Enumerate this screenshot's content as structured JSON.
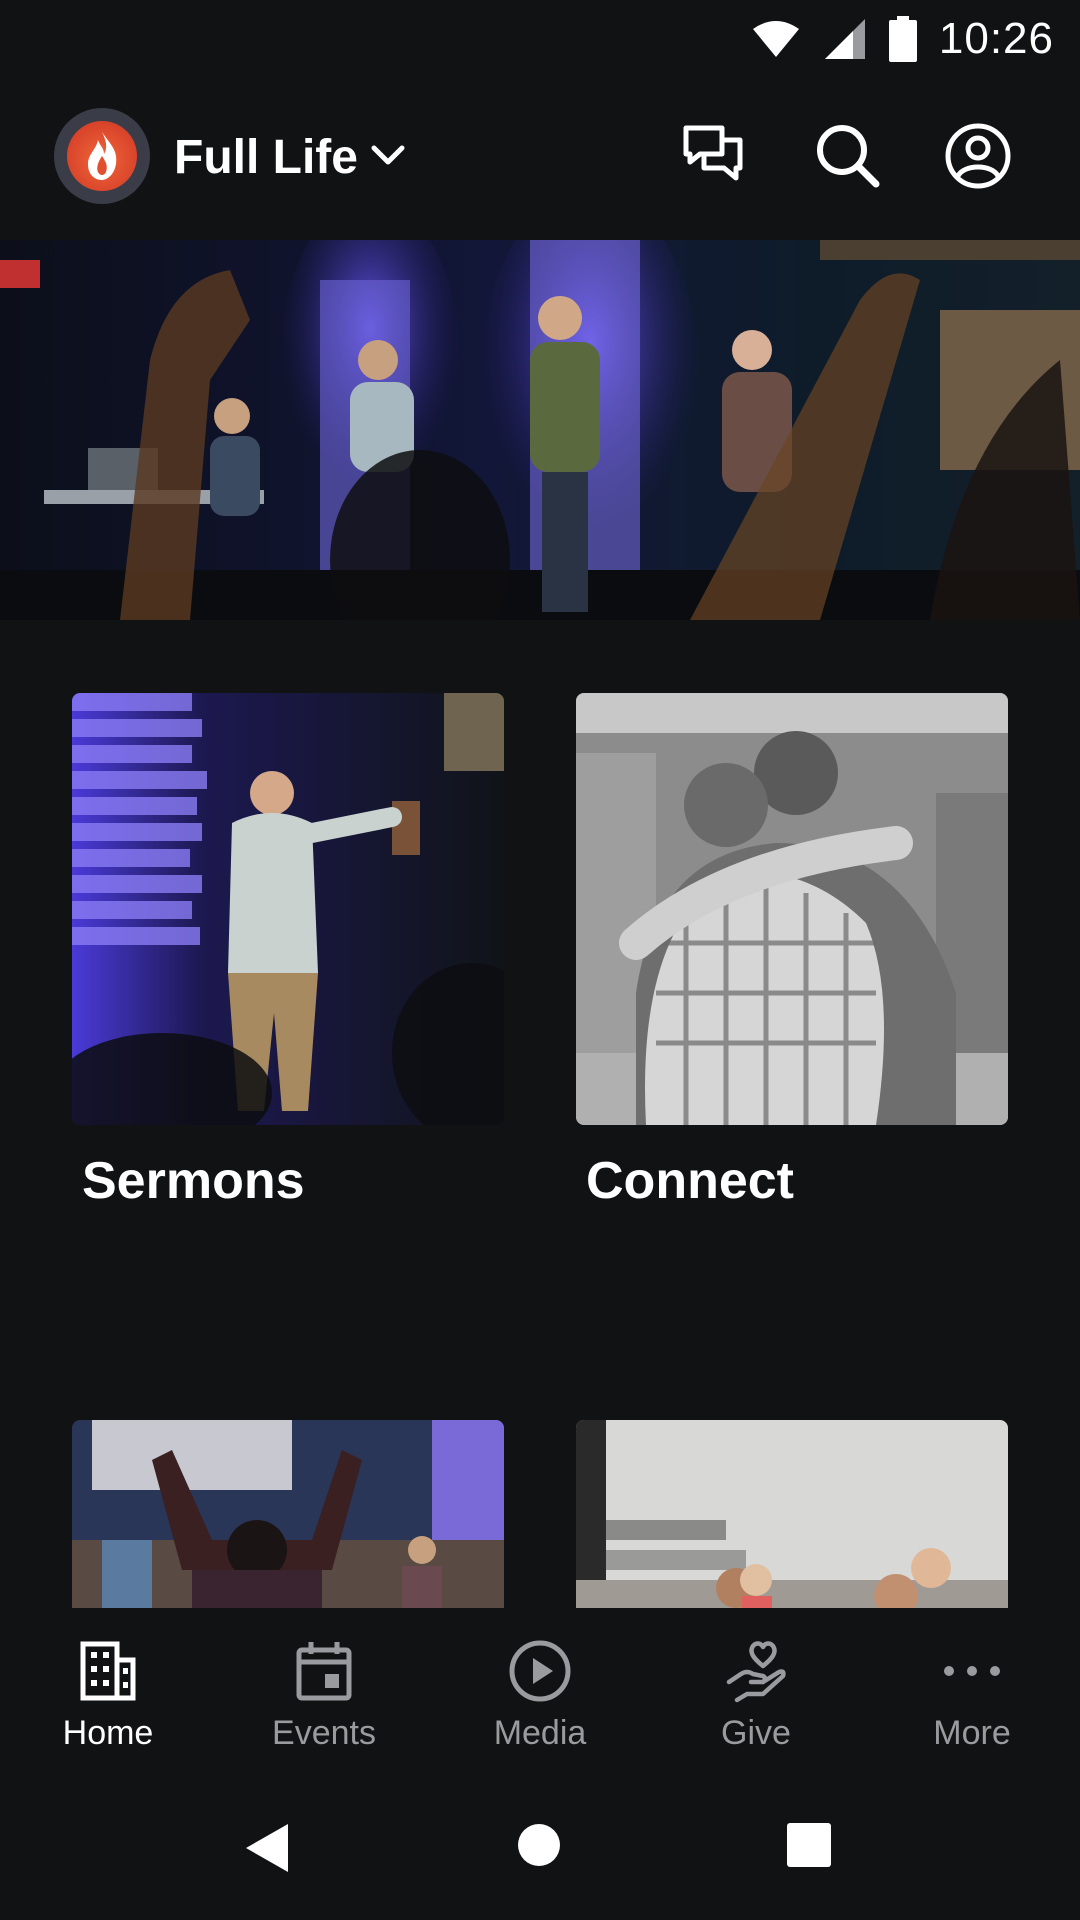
{
  "status_bar": {
    "time": "10:26",
    "icons": [
      "wifi-icon",
      "cell-signal-icon",
      "battery-icon"
    ]
  },
  "header": {
    "church_name": "Full Life",
    "icons": [
      "chat-icon",
      "search-icon",
      "account-icon"
    ]
  },
  "hero": {
    "alt": "worship team on stage"
  },
  "cards": [
    {
      "title": "Sermons"
    },
    {
      "title": "Connect"
    }
  ],
  "bottom_nav": {
    "items": [
      {
        "label": "Home",
        "icon": "building-icon",
        "active": true
      },
      {
        "label": "Events",
        "icon": "calendar-icon",
        "active": false
      },
      {
        "label": "Media",
        "icon": "play-circle-icon",
        "active": false
      },
      {
        "label": "Give",
        "icon": "give-heart-hand-icon",
        "active": false
      },
      {
        "label": "More",
        "icon": "more-dots-icon",
        "active": false
      }
    ]
  },
  "colors": {
    "background": "#111214",
    "active": "#ffffff",
    "inactive": "#9a9b9e",
    "logo_orange": "#e0502f"
  }
}
